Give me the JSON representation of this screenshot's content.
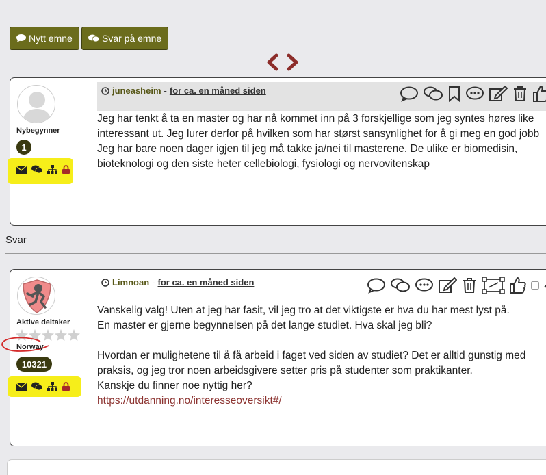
{
  "toolbar": {
    "new_topic_label": "Nytt emne",
    "reply_label": "Svar på emne"
  },
  "pager": {
    "prev_icon": "chevron-left-icon",
    "next_icon": "chevron-right-icon"
  },
  "posts": [
    {
      "author": "juneasheim",
      "separator": " - ",
      "time": "for ca. en måned siden",
      "rank": "Nybegynner",
      "post_count": "1",
      "lines": [
        "Jeg har tenkt å ta en master og har nå kommet inn på 3 forskjellige som jeg syntes høres like",
        "interessant ut. Jeg lurer derfor på hvilken som har størst sansynlighet for å gi meg en god jobb",
        "Jeg har bare noen dager igjen til jeg må takke ja/nei til masterene. De ulike er biomedisin,",
        "bioteknologi og den siste heter cellebiologi, fysiologi og nervovitenskap"
      ]
    },
    {
      "author": "Limnoan",
      "separator": " - ",
      "time": "for ca. en måned siden",
      "rank": "Aktive deltaker",
      "country": "Norway",
      "stars": 0,
      "post_count": "10321",
      "lines": [
        "Vanskelig valg! Uten at jeg har fasit, vil jeg tro at det viktigste er hva du har mest lyst på.",
        "En master er gjerne begynnelsen på det lange studiet. Hva skal jeg bli?",
        "",
        "Hvordan er mulighetene til å få arbeid i faget ved siden av studiet? Det er alltid gunstig med",
        "praksis, og jeg tror noen arbeidsgivere setter pris på studenter som praktikanter.",
        "Kanskje du finner noe nyttig her?"
      ],
      "link": "https://utdanning.no/interesseoversikt#/"
    }
  ],
  "replies_heading": "Svar",
  "colors": {
    "button_bg": "#6b6c1c",
    "accent": "#575717",
    "pager_arrow": "#8c2d2a",
    "highlight": "#f6ee1a",
    "link": "#8c3330"
  }
}
